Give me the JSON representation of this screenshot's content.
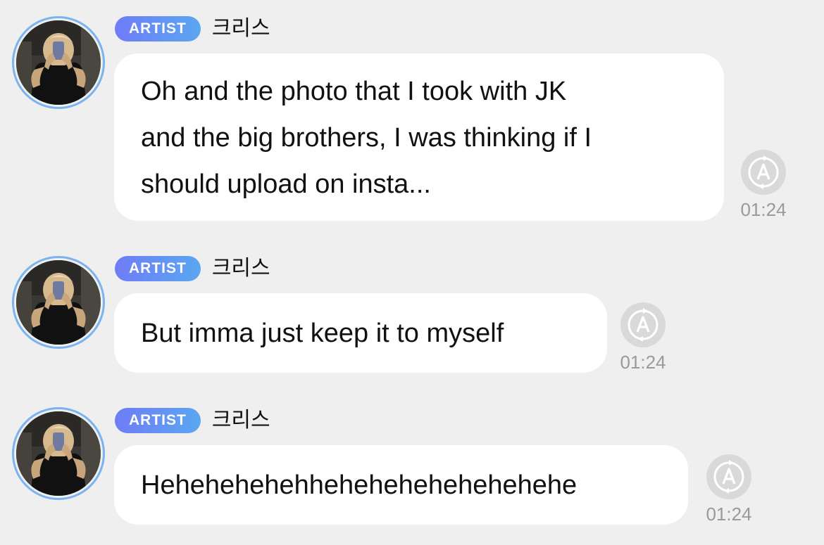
{
  "messages": [
    {
      "badge": "ARTIST",
      "sender": "크리스",
      "lines": [
        "Oh and the photo that I took with JK",
        "and the big brothers, I was thinking if I",
        "should upload on insta..."
      ],
      "time": "01:24",
      "status_icon": "auto-translate-icon"
    },
    {
      "badge": "ARTIST",
      "sender": "크리스",
      "lines": [
        "But imma just keep it to myself"
      ],
      "time": "01:24",
      "status_icon": "auto-translate-icon"
    },
    {
      "badge": "ARTIST",
      "sender": "크리스",
      "lines": [
        "Hehehehehehhehehehehehehehehe"
      ],
      "time": "01:24",
      "status_icon": "auto-translate-icon"
    }
  ],
  "colors": {
    "background": "#efefef",
    "bubble": "#ffffff",
    "badge_gradient_start": "#6f7cf7",
    "badge_gradient_end": "#5aa7f1",
    "avatar_ring": "#79b3f0",
    "timestamp": "#9a9a9a"
  }
}
